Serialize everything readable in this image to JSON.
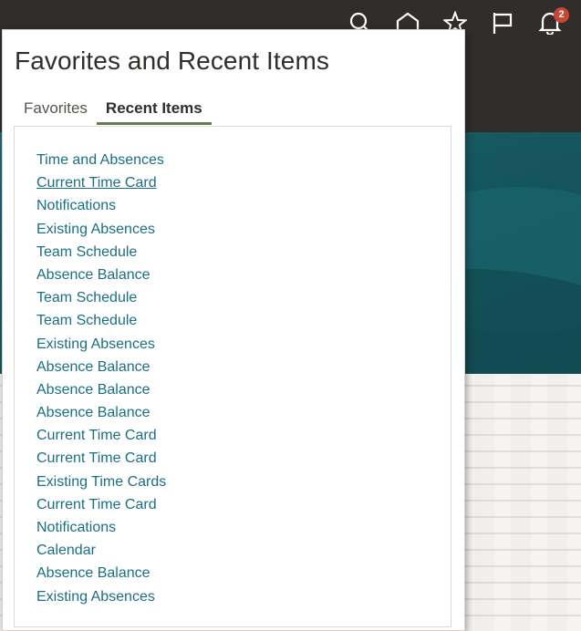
{
  "header": {
    "icons": [
      {
        "name": "search-icon"
      },
      {
        "name": "home-icon"
      },
      {
        "name": "favorites-star-icon"
      },
      {
        "name": "watchlist-flag-icon"
      },
      {
        "name": "notifications-bell-icon"
      }
    ],
    "notification_count": "2",
    "colors": {
      "bar": "#312d2a",
      "badge": "#c74634"
    }
  },
  "popup": {
    "title": "Favorites and Recent Items",
    "tabs": [
      {
        "label": "Favorites",
        "active": false
      },
      {
        "label": "Recent Items",
        "active": true
      }
    ],
    "recent_items": [
      "Time and Absences",
      "Current Time Card",
      "Notifications",
      "Existing Absences",
      "Team Schedule",
      "Absence Balance",
      "Team Schedule",
      "Team Schedule",
      "Existing Absences",
      "Absence Balance",
      "Absence Balance",
      "Absence Balance",
      "Current Time Card",
      "Current Time Card",
      "Existing Time Cards",
      "Current Time Card",
      "Notifications",
      "Calendar",
      "Absence Balance",
      "Existing Absences"
    ],
    "hovered_index": 1,
    "colors": {
      "link": "#1a6f82",
      "active_tab_underline": "#5f7d4f"
    }
  }
}
